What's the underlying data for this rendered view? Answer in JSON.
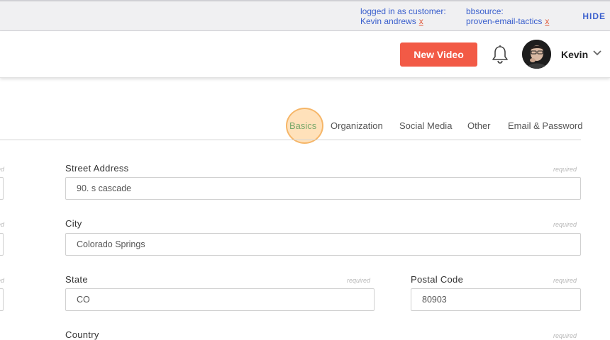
{
  "admin_bar": {
    "customer_label": "logged in as customer:",
    "customer_name": "Kevin andrews",
    "customer_close": "x",
    "source_label": "bbsource:",
    "source_value": "proven-email-tactics",
    "source_close": "x",
    "hide_label": "HIDE",
    "link_color": "#3a5fcd"
  },
  "header": {
    "new_video_label": "New Video",
    "new_video_color": "#f25a46",
    "notification_icon": "bell-icon",
    "user_name": "Kevin",
    "dropdown_icon": "chevron-down-icon"
  },
  "tabs": [
    {
      "label": "Basics",
      "active": true
    },
    {
      "label": "Organization",
      "active": false
    },
    {
      "label": "Social Media",
      "active": false
    },
    {
      "label": "Other",
      "active": false
    },
    {
      "label": "Email & Password",
      "active": false
    }
  ],
  "form": {
    "required_label": "required",
    "left_clipped_required": "ed",
    "street": {
      "label": "Street Address",
      "value": "90. s cascade"
    },
    "city": {
      "label": "City",
      "value": "Colorado Springs"
    },
    "state": {
      "label": "State",
      "value": "CO"
    },
    "postal": {
      "label": "Postal Code",
      "value": "80903"
    },
    "country": {
      "label": "Country"
    }
  }
}
